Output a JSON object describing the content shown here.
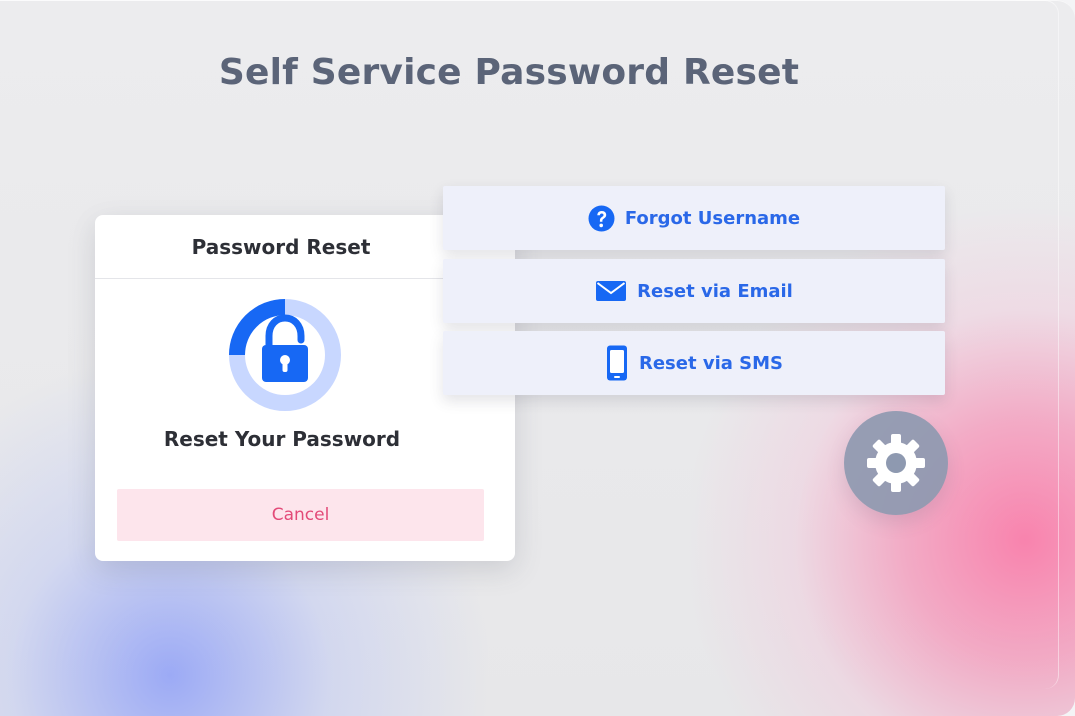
{
  "page": {
    "title": "Self Service Password Reset"
  },
  "reset_card": {
    "header": "Password Reset",
    "message": "Reset Your Password",
    "cancel_label": "Cancel"
  },
  "options": [
    {
      "label": "Forgot Username",
      "icon": "question-circle-icon"
    },
    {
      "label": "Reset via Email",
      "icon": "envelope-icon"
    },
    {
      "label": "Reset via SMS",
      "icon": "mobile-phone-icon"
    }
  ],
  "settings": {
    "icon": "gear-icon"
  },
  "colors": {
    "title": "#5b6478",
    "accent": "#2a68e8",
    "cancel_background": "#fde5ec",
    "cancel_text": "#e34a78",
    "settings_background": "#8e99b0"
  }
}
